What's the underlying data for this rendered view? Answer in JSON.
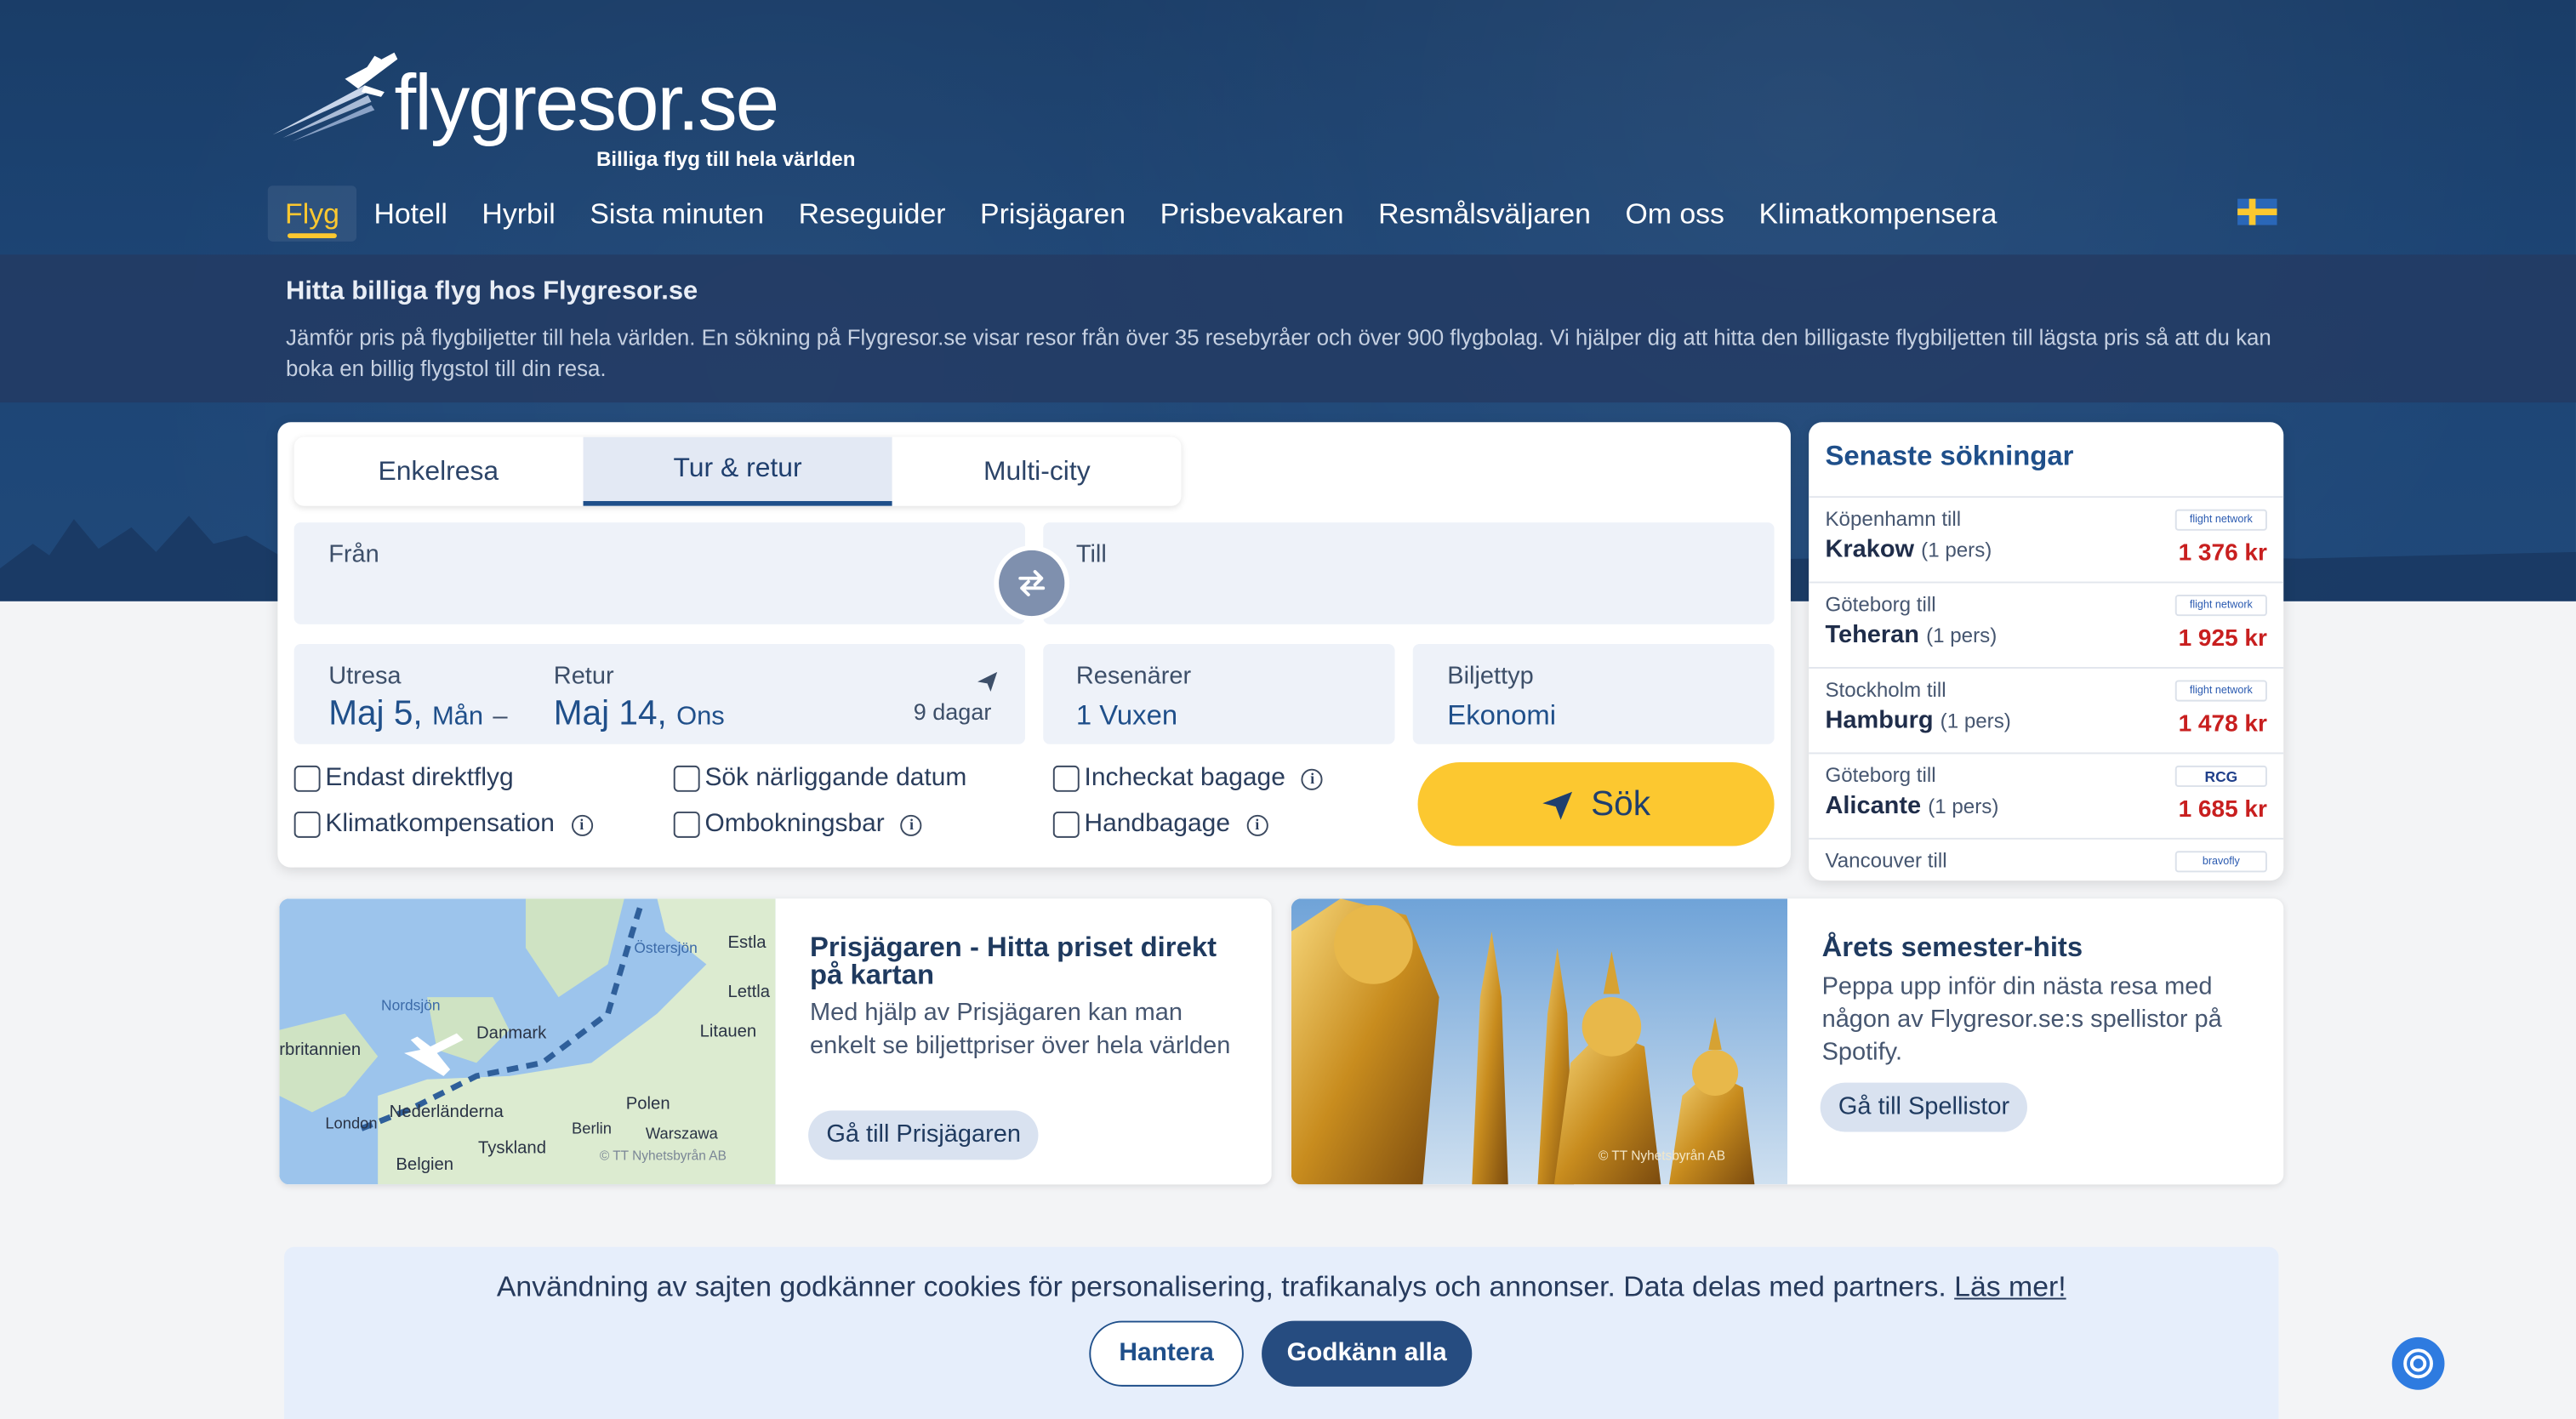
{
  "brand": {
    "name": "flygresor.se",
    "tagline": "Billiga flyg till hela världen"
  },
  "nav": {
    "items": [
      "Flyg",
      "Hotell",
      "Hyrbil",
      "Sista minuten",
      "Reseguider",
      "Prisjägaren",
      "Prisbevakaren",
      "Resmålsväljaren",
      "Om oss",
      "Klimatkompensera"
    ],
    "active": "Flyg",
    "language_icon": "sweden-flag-icon"
  },
  "intro": {
    "title": "Hitta billiga flyg hos Flygresor.se",
    "text": "Jämför pris på flygbiljetter till hela världen. En sökning på Flygresor.se visar resor från över 35 resebyråer och över 900 flygbolag. Vi hjälper dig att hitta den billigaste flygbiljetten till lägsta pris så att du kan boka en billig flygstol till din resa."
  },
  "search": {
    "tabs": [
      "Enkelresa",
      "Tur & retur",
      "Multi-city"
    ],
    "active_tab": "Tur & retur",
    "from_label": "Från",
    "to_label": "Till",
    "outbound_label": "Utresa",
    "outbound_date": "Maj 5,",
    "outbound_day": "Mån",
    "dash": "–",
    "return_label": "Retur",
    "return_date": "Maj 14,",
    "return_day": "Ons",
    "duration": "9 dagar",
    "travelers_label": "Resenärer",
    "travelers_value": "1 Vuxen",
    "ticket_label": "Biljettyp",
    "ticket_value": "Ekonomi",
    "options": [
      "Endast direktflyg",
      "Klimatkompensation",
      "Sök närliggande datum",
      "Ombokningsbar",
      "Incheckat bagage",
      "Handbagage"
    ],
    "info_glyph": "i",
    "search_button": "Sök"
  },
  "recent": {
    "title": "Senaste sökningar",
    "rows": [
      {
        "from": "Köpenhamn till",
        "to": "Krakow",
        "pax": "(1 pers)",
        "price": "1 376 kr",
        "agency": "flight network"
      },
      {
        "from": "Göteborg till",
        "to": "Teheran",
        "pax": "(1 pers)",
        "price": "1 925 kr",
        "agency": "flight network"
      },
      {
        "from": "Stockholm till",
        "to": "Hamburg",
        "pax": "(1 pers)",
        "price": "1 478 kr",
        "agency": "flight network"
      },
      {
        "from": "Göteborg till",
        "to": "Alicante",
        "pax": "(1 pers)",
        "price": "1 685 kr",
        "agency": "RCG"
      },
      {
        "from": "Vancouver till",
        "to": "",
        "pax": "",
        "price": "",
        "agency": "bravofly"
      }
    ]
  },
  "cards": [
    {
      "title": "Prisjägaren - Hitta priset direkt på kartan",
      "text": "Med hjälp av Prisjägaren kan man enkelt se biljettpriser över hela världen",
      "button": "Gå till Prisjägaren",
      "credit": "© TT Nyhetsbyrån AB",
      "map_labels": [
        "Östersjön",
        "Estla",
        "Lettla",
        "Nordsjön",
        "rbritannien",
        "Danmark",
        "Litauen",
        "Nederländerna",
        "Polen",
        "London",
        "Berlin",
        "Warszawa",
        "Tyskland",
        "Belgien"
      ]
    },
    {
      "title": "Årets semester-hits",
      "text": "Peppa upp inför din nästa resa med någon av Flygresor.se:s spellistor på Spotify.",
      "button": "Gå till Spellistor",
      "credit": "© TT Nyhetsbyrån AB"
    }
  ],
  "cookie": {
    "text": "Användning av sajten godkänner cookies för personalisering, trafikanalys och annonser. Data delas med partners.",
    "link": "Läs mer!",
    "manage": "Hantera",
    "accept": "Godkänn alla"
  },
  "colors": {
    "navy": "#1c4474",
    "accent": "#fcc830",
    "price_red": "#c81f1f",
    "link_blue": "#1f4f8a"
  }
}
